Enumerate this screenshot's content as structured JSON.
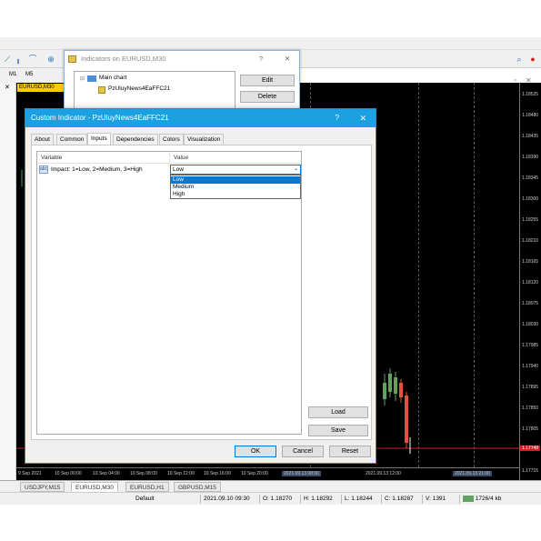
{
  "app": {
    "toolbar_small": [
      "M1",
      "M5"
    ]
  },
  "chart": {
    "tag": "EURUSD,M30",
    "price_labels": [
      "1.18525",
      "1.18480",
      "1.18435",
      "1.18390",
      "1.18345",
      "1.18300",
      "1.18255",
      "1.18210",
      "1.18165",
      "1.18120",
      "1.18075",
      "1.18030",
      "1.17985",
      "1.17940",
      "1.17895",
      "1.17850",
      "1.17805",
      "1.17760",
      "1.17715"
    ],
    "current_price": "1.17748",
    "time_labels": [
      "9 Sep 2021",
      "10 Sep 00:00",
      "10 Sep 04:00",
      "10 Sep 08:00",
      "10 Sep 12:00",
      "10 Sep 16:00",
      "10 Sep 20:00",
      "2021.09.13 08:00",
      "2021.09.13 12:00",
      "2021.09.13 21:00"
    ]
  },
  "tabs": [
    "USDJPY,M15",
    "EURUSD,M30",
    "EURUSD,H1",
    "GBPUSD,M15"
  ],
  "status": {
    "profile": "Default",
    "datetime": "2021.09.10 09:30",
    "open": "O: 1.18270",
    "high": "H: 1.18292",
    "low": "L: 1.18244",
    "close": "C: 1.18287",
    "volume": "V: 1391",
    "traffic": "1726/4 kb"
  },
  "indicators_window": {
    "title": "Indicators on EURUSD,M30",
    "help": "?",
    "close": "✕",
    "tree_root": "Main chart",
    "tree_child": "PzUluyNews4EaFFC21",
    "edit_label": "Edit",
    "delete_label": "Delete"
  },
  "custom_indicator": {
    "title": "Custom Indicator - PzUluyNews4EaFFC21",
    "help": "?",
    "close": "✕",
    "tabs": [
      "About",
      "Common",
      "Inputs",
      "Dependencies",
      "Colors",
      "Visualization"
    ],
    "active_tab": "Inputs",
    "columns": {
      "variable": "Variable",
      "value": "Value"
    },
    "row": {
      "icon": "abc",
      "variable": "Impact: 1=Low, 2=Medium, 3=High",
      "value": "Low"
    },
    "options": [
      "Low",
      "Medium",
      "High"
    ],
    "selected_option": "Low",
    "load_label": "Load",
    "save_label": "Save",
    "ok_label": "OK",
    "cancel_label": "Cancel",
    "reset_label": "Reset"
  },
  "colors": {
    "accent": "#1ba1e2",
    "chart_bg": "#000000",
    "bull": "#5fa35f",
    "bear": "#e0523a",
    "price_line": "#cc2222"
  }
}
